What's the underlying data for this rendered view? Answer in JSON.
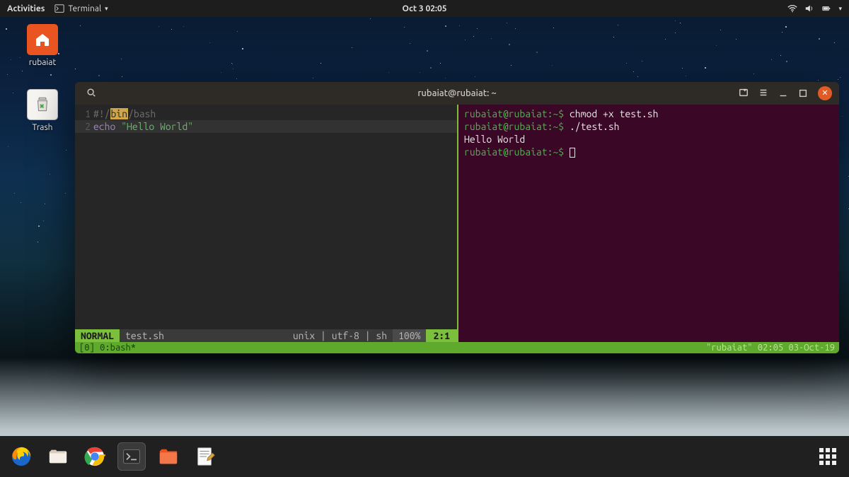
{
  "topbar": {
    "activities": "Activities",
    "app_menu": "Terminal",
    "clock": "Oct 3  02:05"
  },
  "desktop": {
    "home_label": "rubaiat",
    "trash_label": "Trash"
  },
  "window": {
    "title": "rubaiat@rubaiat: ~"
  },
  "vim": {
    "line1_a": "#!/",
    "line1_hl": "bin",
    "line1_b": "/bash",
    "line2_stmt": "echo",
    "line2_str": " \"Hello World\"",
    "gutter1": "1",
    "gutter2": "2",
    "status": {
      "mode": "NORMAL",
      "filename": "test.sh",
      "meta": "unix | utf-8 | sh",
      "percent": "100%",
      "position": "2:1"
    }
  },
  "shell": {
    "prompt": "rubaiat@rubaiat:~$",
    "cmd1": " chmod +x test.sh",
    "cmd2": " ./test.sh",
    "out1": "Hello World"
  },
  "tmux": {
    "left": "[0] 0:bash*",
    "right": "\"rubaiat\" 02:05 03-Oct-19"
  }
}
